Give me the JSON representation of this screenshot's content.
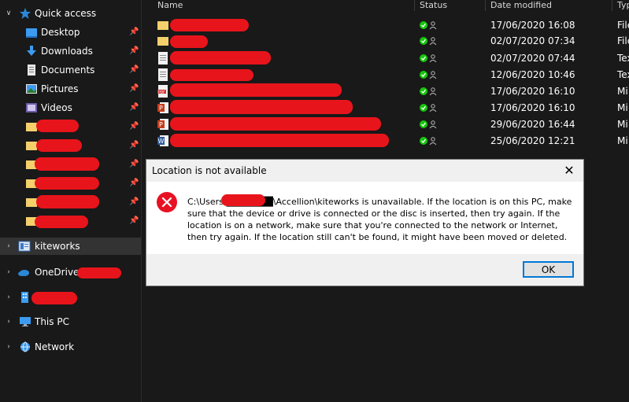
{
  "sidebar": {
    "quick_access": "Quick access",
    "pinned": [
      "Desktop",
      "Downloads",
      "Documents",
      "Pictures",
      "Videos"
    ],
    "kiteworks": "kiteworks",
    "onedrive": "OneDrive",
    "this_pc": "This PC",
    "network": "Network"
  },
  "columns": {
    "name": "Name",
    "status": "Status",
    "date": "Date modified",
    "type": "Typ"
  },
  "rows": [
    {
      "icon": "folder-icon",
      "date": "17/06/2020 16:08",
      "type": "File"
    },
    {
      "icon": "folder-icon",
      "date": "02/07/2020 07:34",
      "type": "File"
    },
    {
      "icon": "text-file-icon",
      "date": "02/07/2020 07:44",
      "type": "Tex"
    },
    {
      "icon": "text-file-icon",
      "date": "12/06/2020 10:46",
      "type": "Tex"
    },
    {
      "icon": "pdf-file-icon",
      "date": "17/06/2020 16:10",
      "type": "Mi"
    },
    {
      "icon": "powerpoint-file-icon",
      "date": "17/06/2020 16:10",
      "type": "Mi"
    },
    {
      "icon": "powerpoint-file-icon",
      "date": "29/06/2020 16:44",
      "type": "Mi"
    },
    {
      "icon": "word-file-icon",
      "date": "25/06/2020 12:21",
      "type": "Mi"
    }
  ],
  "dialog": {
    "title": "Location is not available",
    "message": "C:\\Users\\███████\\Accellion\\kiteworks is unavailable. If the location is on this PC, make sure that the device or drive is connected or the disc is inserted, then try again. If the location is on a network, make sure that you're connected to the network or Internet, then try again. If the location still can't be found, it might have been moved or deleted.",
    "ok": "OK"
  },
  "colors": {
    "accent": "#0078d7",
    "error": "#e81123",
    "status_ok": "#16c60c"
  }
}
